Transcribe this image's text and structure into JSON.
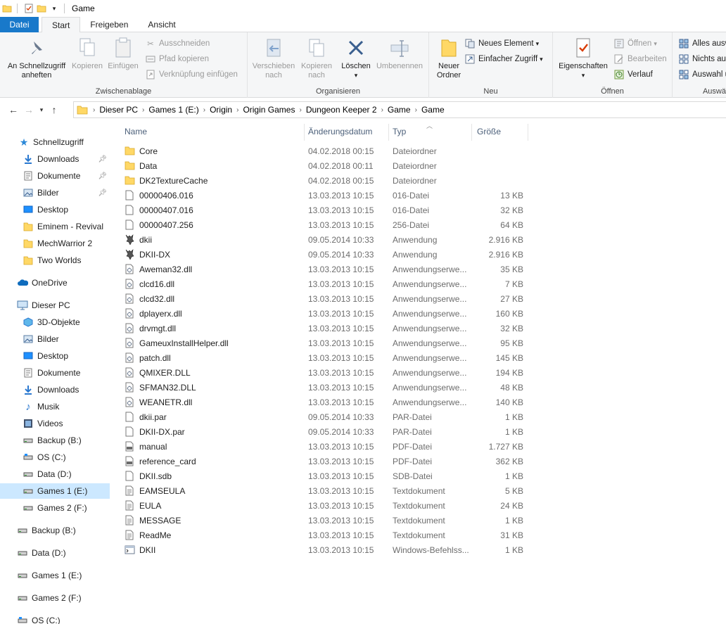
{
  "window": {
    "title": "Game"
  },
  "tabs": [
    "Datei",
    "Start",
    "Freigeben",
    "Ansicht"
  ],
  "ribbon": {
    "clipboard": {
      "pin_label_1": "An Schnellzugriff",
      "pin_label_2": "anheften",
      "copy": "Kopieren",
      "paste": "Einfügen",
      "cut": "Ausschneiden",
      "copy_path": "Pfad kopieren",
      "paste_shortcut": "Verknüpfung einfügen",
      "group": "Zwischenablage"
    },
    "organize": {
      "move_1": "Verschieben",
      "move_2": "nach",
      "copyto_1": "Kopieren",
      "copyto_2": "nach",
      "delete": "Löschen",
      "rename": "Umbenennen",
      "group": "Organisieren"
    },
    "new": {
      "folder_1": "Neuer",
      "folder_2": "Ordner",
      "new_item": "Neues Element",
      "easy_access": "Einfacher Zugriff",
      "group": "Neu"
    },
    "open": {
      "properties": "Eigenschaften",
      "open": "Öffnen",
      "edit": "Bearbeiten",
      "history": "Verlauf",
      "group": "Öffnen"
    },
    "select": {
      "all": "Alles ausw",
      "none": "Nichts au",
      "invert": "Auswahl u",
      "group": "Auswä"
    }
  },
  "address": {
    "crumbs": [
      "Dieser PC",
      "Games 1 (E:)",
      "Origin",
      "Origin Games",
      "Dungeon Keeper 2",
      "Game",
      "Game"
    ]
  },
  "sidebar": {
    "quick_access": "Schnellzugriff",
    "quick_items": [
      "Downloads",
      "Dokumente",
      "Bilder",
      "Desktop",
      "Eminem - Revival",
      "MechWarrior 2",
      "Two Worlds"
    ],
    "onedrive": "OneDrive",
    "this_pc": "Dieser PC",
    "pc_items": [
      "3D-Objekte",
      "Bilder",
      "Desktop",
      "Dokumente",
      "Downloads",
      "Musik",
      "Videos",
      "Backup (B:)",
      "OS (C:)",
      "Data (D:)",
      "Games 1 (E:)",
      "Games 2 (F:)"
    ],
    "drives": [
      "Backup (B:)",
      "Data (D:)",
      "Games 1 (E:)",
      "Games 2 (F:)",
      "OS (C:)"
    ]
  },
  "columns": {
    "name": "Name",
    "date": "Änderungsdatum",
    "type": "Typ",
    "size": "Größe"
  },
  "files": [
    {
      "name": "Core",
      "date": "04.02.2018 00:15",
      "type": "Dateiordner",
      "size": "",
      "icon": "folder"
    },
    {
      "name": "Data",
      "date": "04.02.2018 00:11",
      "type": "Dateiordner",
      "size": "",
      "icon": "folder"
    },
    {
      "name": "DK2TextureCache",
      "date": "04.02.2018 00:15",
      "type": "Dateiordner",
      "size": "",
      "icon": "folder"
    },
    {
      "name": "00000406.016",
      "date": "13.03.2013 10:15",
      "type": "016-Datei",
      "size": "13 KB",
      "icon": "file"
    },
    {
      "name": "00000407.016",
      "date": "13.03.2013 10:15",
      "type": "016-Datei",
      "size": "32 KB",
      "icon": "file"
    },
    {
      "name": "00000407.256",
      "date": "13.03.2013 10:15",
      "type": "256-Datei",
      "size": "64 KB",
      "icon": "file"
    },
    {
      "name": "dkii",
      "date": "09.05.2014 10:33",
      "type": "Anwendung",
      "size": "2.916 KB",
      "icon": "app"
    },
    {
      "name": "DKII-DX",
      "date": "09.05.2014 10:33",
      "type": "Anwendung",
      "size": "2.916 KB",
      "icon": "app"
    },
    {
      "name": "Aweman32.dll",
      "date": "13.03.2013 10:15",
      "type": "Anwendungserwe...",
      "size": "35 KB",
      "icon": "dll"
    },
    {
      "name": "clcd16.dll",
      "date": "13.03.2013 10:15",
      "type": "Anwendungserwe...",
      "size": "7 KB",
      "icon": "dll"
    },
    {
      "name": "clcd32.dll",
      "date": "13.03.2013 10:15",
      "type": "Anwendungserwe...",
      "size": "27 KB",
      "icon": "dll"
    },
    {
      "name": "dplayerx.dll",
      "date": "13.03.2013 10:15",
      "type": "Anwendungserwe...",
      "size": "160 KB",
      "icon": "dll"
    },
    {
      "name": "drvmgt.dll",
      "date": "13.03.2013 10:15",
      "type": "Anwendungserwe...",
      "size": "32 KB",
      "icon": "dll"
    },
    {
      "name": "GameuxInstallHelper.dll",
      "date": "13.03.2013 10:15",
      "type": "Anwendungserwe...",
      "size": "95 KB",
      "icon": "dll"
    },
    {
      "name": "patch.dll",
      "date": "13.03.2013 10:15",
      "type": "Anwendungserwe...",
      "size": "145 KB",
      "icon": "dll"
    },
    {
      "name": "QMIXER.DLL",
      "date": "13.03.2013 10:15",
      "type": "Anwendungserwe...",
      "size": "194 KB",
      "icon": "dll"
    },
    {
      "name": "SFMAN32.DLL",
      "date": "13.03.2013 10:15",
      "type": "Anwendungserwe...",
      "size": "48 KB",
      "icon": "dll"
    },
    {
      "name": "WEANETR.dll",
      "date": "13.03.2013 10:15",
      "type": "Anwendungserwe...",
      "size": "140 KB",
      "icon": "dll"
    },
    {
      "name": "dkii.par",
      "date": "09.05.2014 10:33",
      "type": "PAR-Datei",
      "size": "1 KB",
      "icon": "file"
    },
    {
      "name": "DKII-DX.par",
      "date": "09.05.2014 10:33",
      "type": "PAR-Datei",
      "size": "1 KB",
      "icon": "file"
    },
    {
      "name": "manual",
      "date": "13.03.2013 10:15",
      "type": "PDF-Datei",
      "size": "1.727 KB",
      "icon": "pdf"
    },
    {
      "name": "reference_card",
      "date": "13.03.2013 10:15",
      "type": "PDF-Datei",
      "size": "362 KB",
      "icon": "pdf"
    },
    {
      "name": "DKII.sdb",
      "date": "13.03.2013 10:15",
      "type": "SDB-Datei",
      "size": "1 KB",
      "icon": "file"
    },
    {
      "name": "EAMSEULA",
      "date": "13.03.2013 10:15",
      "type": "Textdokument",
      "size": "5 KB",
      "icon": "text"
    },
    {
      "name": "EULA",
      "date": "13.03.2013 10:15",
      "type": "Textdokument",
      "size": "24 KB",
      "icon": "text"
    },
    {
      "name": "MESSAGE",
      "date": "13.03.2013 10:15",
      "type": "Textdokument",
      "size": "1 KB",
      "icon": "text"
    },
    {
      "name": "ReadMe",
      "date": "13.03.2013 10:15",
      "type": "Textdokument",
      "size": "31 KB",
      "icon": "text"
    },
    {
      "name": "DKII",
      "date": "13.03.2013 10:15",
      "type": "Windows-Befehlss...",
      "size": "1 KB",
      "icon": "cmd"
    }
  ]
}
